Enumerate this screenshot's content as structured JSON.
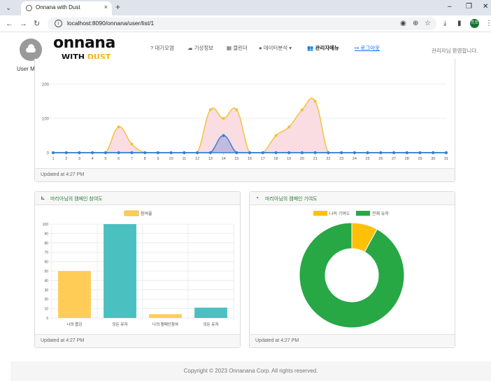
{
  "browser": {
    "tab_title": "Onnana with Dust",
    "tab_close": "×",
    "new_tab": "+",
    "url": "localhost:8090/onnana/user/list/1",
    "window_buttons": [
      "–",
      "❐",
      "✕"
    ],
    "profile_initials": "프로"
  },
  "nav": {
    "logo_main": "onnana",
    "logo_sub1": "WITH ",
    "logo_sub2": "DUST",
    "user_menu": "User Menu",
    "items": [
      "? 대기오염",
      "기상정보",
      "캘린더",
      "데이터분석 ▾",
      "관리자메뉴",
      "로그아웃"
    ],
    "greeting": "관리자님 환영합니다."
  },
  "cards": {
    "line_footer": "Updated at 4:27 PM",
    "bar_title": "마리아님의 캠페인 참여도",
    "bar_footer": "Updated at 4:27 PM",
    "donut_title": "마리아님의 캠페인 기여도",
    "donut_footer": "Updated at 4:27 PM"
  },
  "footer": "Copyright © 2023 Onnanana Corp. All rights reserved.",
  "colors": {
    "yellow": "#ffcd56",
    "yellow_line": "#f2c12e",
    "pink_fill": "#fadce3",
    "blue": "#2f7fd1",
    "teal": "#4bc0c0",
    "green": "#28a745",
    "donut_yellow": "#ffc107"
  },
  "chart_data": [
    {
      "type": "line",
      "x": [
        1,
        2,
        3,
        4,
        5,
        6,
        7,
        8,
        9,
        10,
        11,
        12,
        13,
        14,
        15,
        16,
        17,
        18,
        19,
        20,
        21,
        22,
        23,
        24,
        25,
        26,
        27,
        28,
        29,
        30,
        31
      ],
      "series": [
        {
          "values": [
            0,
            0,
            0,
            0,
            0,
            75,
            25,
            0,
            0,
            0,
            0,
            0,
            125,
            100,
            125,
            0,
            0,
            50,
            75,
            125,
            150,
            0,
            0,
            0,
            0,
            0,
            0,
            0,
            0,
            0,
            0
          ]
        },
        {
          "values": [
            0,
            0,
            0,
            0,
            0,
            0,
            0,
            0,
            0,
            0,
            0,
            0,
            0,
            50,
            0,
            0,
            0,
            0,
            0,
            0,
            0,
            0,
            0,
            0,
            0,
            0,
            0,
            0,
            0,
            0,
            0
          ]
        }
      ],
      "y_ticks": [
        "0",
        "100",
        "200"
      ],
      "ylim": [
        0,
        200
      ],
      "grid": true
    },
    {
      "type": "bar",
      "categories": [
        "나의 줍깅",
        "모든 유저",
        "나의 캠페인참여",
        "모든 유저"
      ],
      "values": [
        50,
        100,
        4,
        11
      ],
      "series_name": "참여율",
      "y_ticks": [
        "0",
        "10",
        "20",
        "30",
        "40",
        "50",
        "60",
        "70",
        "80",
        "90",
        "100"
      ],
      "ylim": [
        0,
        100
      ],
      "legend": "top"
    },
    {
      "type": "pie",
      "labels": [
        "나의 기여도",
        "전체 유저"
      ],
      "values": [
        8,
        92
      ],
      "legend": "top"
    }
  ]
}
